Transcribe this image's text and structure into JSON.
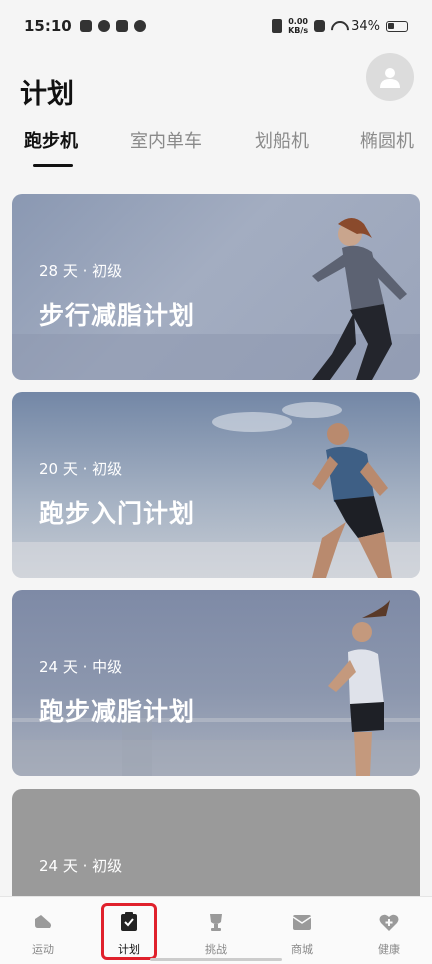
{
  "status": {
    "time": "15:10",
    "net_speed_value": "0.00",
    "net_speed_unit": "KB/s",
    "battery": "34%"
  },
  "header": {
    "title": "计划"
  },
  "tabs": [
    {
      "label": "跑步机"
    },
    {
      "label": "室内单车"
    },
    {
      "label": "划船机"
    },
    {
      "label": "椭圆机"
    }
  ],
  "plans": [
    {
      "meta": "28 天 · 初级",
      "title": "步行减脂计划"
    },
    {
      "meta": "20 天 · 初级",
      "title": "跑步入门计划"
    },
    {
      "meta": "24 天 · 中级",
      "title": "跑步减脂计划"
    },
    {
      "meta": "24 天 · 初级",
      "title": ""
    }
  ],
  "tabbar": [
    {
      "label": "运动",
      "icon": "shoe-icon"
    },
    {
      "label": "计划",
      "icon": "clipboard-check-icon"
    },
    {
      "label": "挑战",
      "icon": "trophy-icon"
    },
    {
      "label": "商城",
      "icon": "mail-icon"
    },
    {
      "label": "健康",
      "icon": "heart-plus-icon"
    }
  ]
}
